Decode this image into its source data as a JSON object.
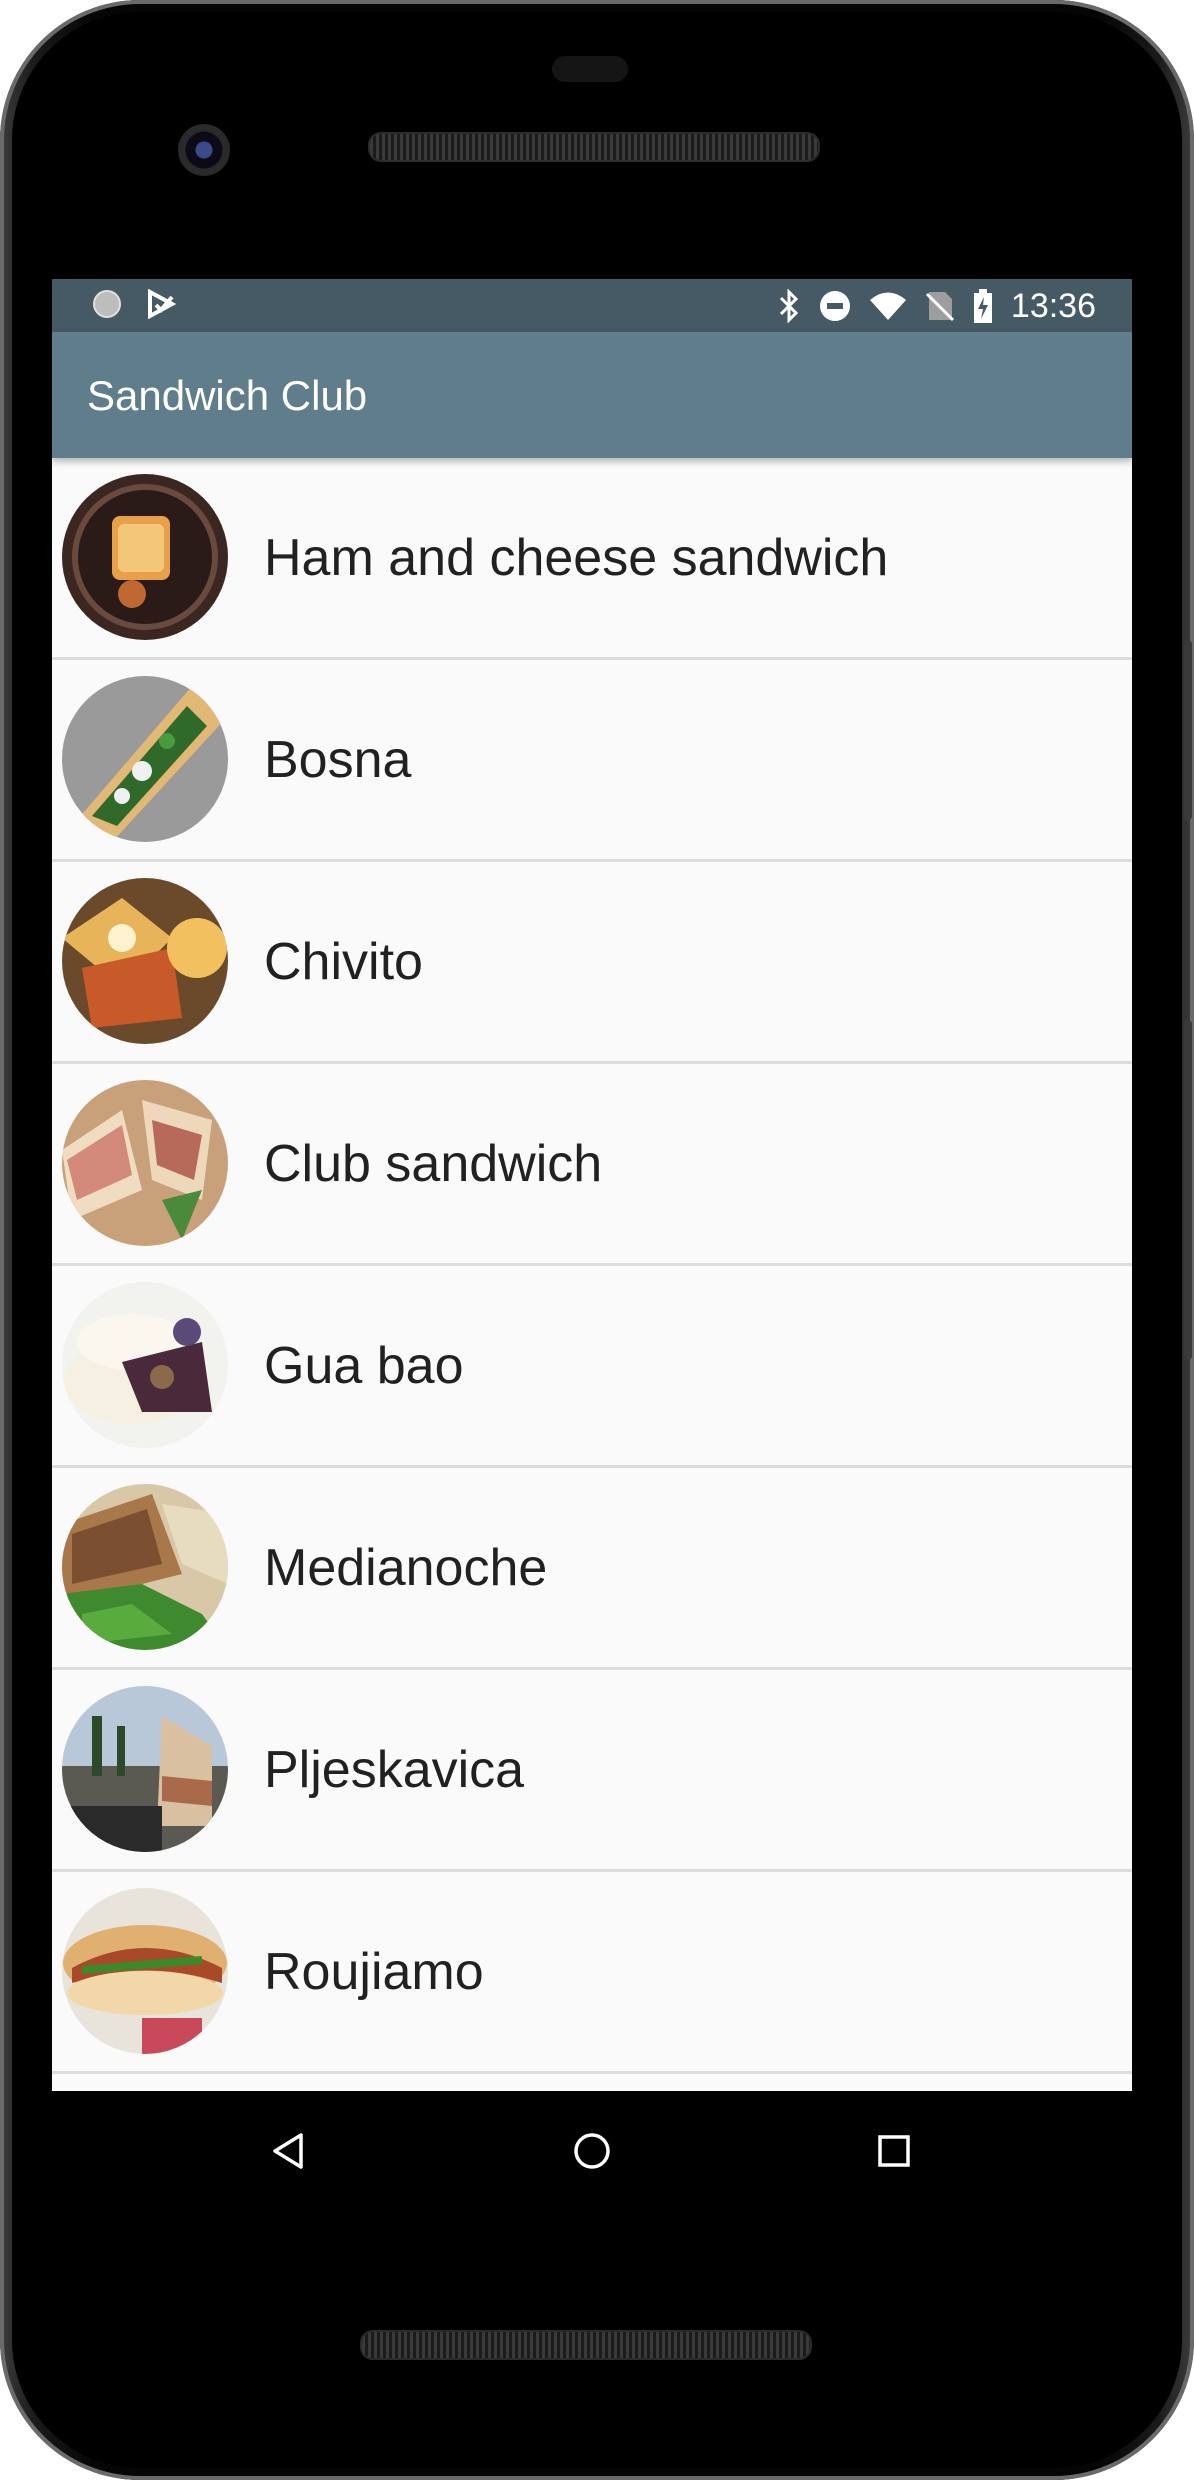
{
  "status_bar": {
    "time": "13:36",
    "left_icons": [
      "notification-dot-icon",
      "play-store-icon"
    ],
    "right_icons": [
      "bluetooth-icon",
      "do-not-disturb-icon",
      "wifi-icon",
      "no-sim-icon",
      "battery-charging-icon"
    ]
  },
  "app_bar": {
    "title": "Sandwich Club",
    "color": "#607d8b",
    "status_color": "#455a64"
  },
  "sandwich_list": {
    "items": [
      {
        "name": "Ham and cheese sandwich"
      },
      {
        "name": "Bosna"
      },
      {
        "name": "Chivito"
      },
      {
        "name": "Club sandwich"
      },
      {
        "name": "Gua bao"
      },
      {
        "name": "Medianoche"
      },
      {
        "name": "Pljeskavica"
      },
      {
        "name": "Roujiamo"
      }
    ]
  },
  "nav_bar": {
    "buttons": [
      "back-icon",
      "home-icon",
      "recents-icon"
    ]
  }
}
